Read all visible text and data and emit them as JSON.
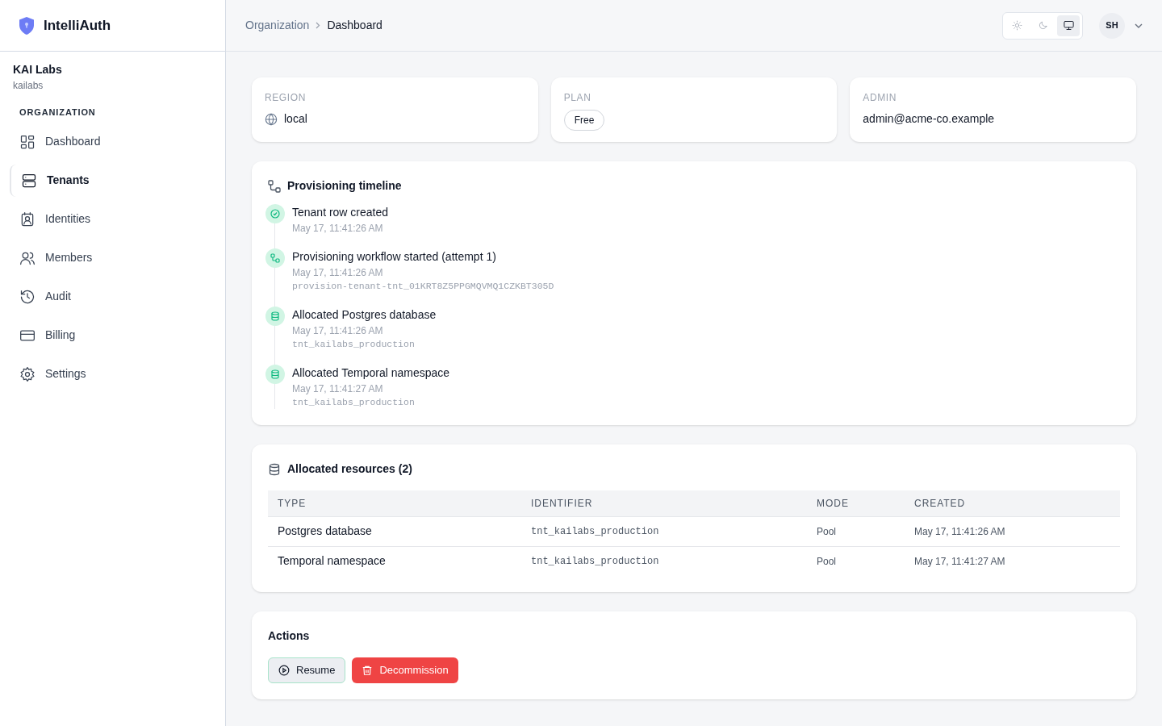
{
  "brand": {
    "name": "IntelliAuth"
  },
  "org": {
    "name": "KAI Labs",
    "slug": "kailabs",
    "section": "ORGANIZATION"
  },
  "nav": [
    {
      "label": "Dashboard",
      "kind": "grid",
      "selected": false
    },
    {
      "label": "Tenants",
      "kind": "server",
      "selected": true
    },
    {
      "label": "Identities",
      "kind": "badge",
      "selected": false
    },
    {
      "label": "Members",
      "kind": "users",
      "selected": false
    },
    {
      "label": "Audit",
      "kind": "history",
      "selected": false
    },
    {
      "label": "Billing",
      "kind": "card",
      "selected": false
    },
    {
      "label": "Settings",
      "kind": "gear",
      "selected": false
    }
  ],
  "breadcrumb": [
    {
      "label": "Organization",
      "current": false
    },
    {
      "label": "Dashboard",
      "current": true
    }
  ],
  "theme_switcher": [
    {
      "kind": "sun",
      "selected": false
    },
    {
      "kind": "moon",
      "selected": false
    },
    {
      "kind": "monitor",
      "selected": true
    }
  ],
  "user": {
    "initials": "SH"
  },
  "info_cards": [
    {
      "label": "REGION",
      "kind": "globe",
      "value": "local"
    },
    {
      "label": "PLAN",
      "kind": "badge",
      "value": "Free"
    },
    {
      "label": "ADMIN",
      "kind": "text",
      "value": "admin@acme-co.example"
    }
  ],
  "timeline": {
    "title": "Provisioning timeline",
    "events": [
      {
        "kind": "check",
        "title": "Tenant row created",
        "time": "May 17, 11:41:26 AM"
      },
      {
        "kind": "workflow",
        "title": "Provisioning workflow started (attempt 1)",
        "time": "May 17, 11:41:26 AM",
        "detail": "provision-tenant-tnt_01KRT8Z5PPGMQVMQ1CZKBT305D"
      },
      {
        "kind": "database",
        "title": "Allocated Postgres database",
        "time": "May 17, 11:41:26 AM",
        "detail": "tnt_kailabs_production"
      },
      {
        "kind": "database",
        "title": "Allocated Temporal namespace",
        "time": "May 17, 11:41:27 AM",
        "detail": "tnt_kailabs_production"
      }
    ]
  },
  "resources": {
    "title": "Allocated resources (2)",
    "columns": [
      "TYPE",
      "IDENTIFIER",
      "MODE",
      "CREATED"
    ],
    "rows": [
      [
        "Postgres database",
        "tnt_kailabs_production",
        "Pool",
        "May 17, 11:41:26 AM"
      ],
      [
        "Temporal namespace",
        "tnt_kailabs_production",
        "Pool",
        "May 17, 11:41:27 AM"
      ]
    ]
  },
  "actions": {
    "title": "Actions",
    "buttons": [
      {
        "label": "Resume",
        "kind": "resume"
      },
      {
        "label": "Decommission",
        "kind": "danger"
      }
    ]
  }
}
